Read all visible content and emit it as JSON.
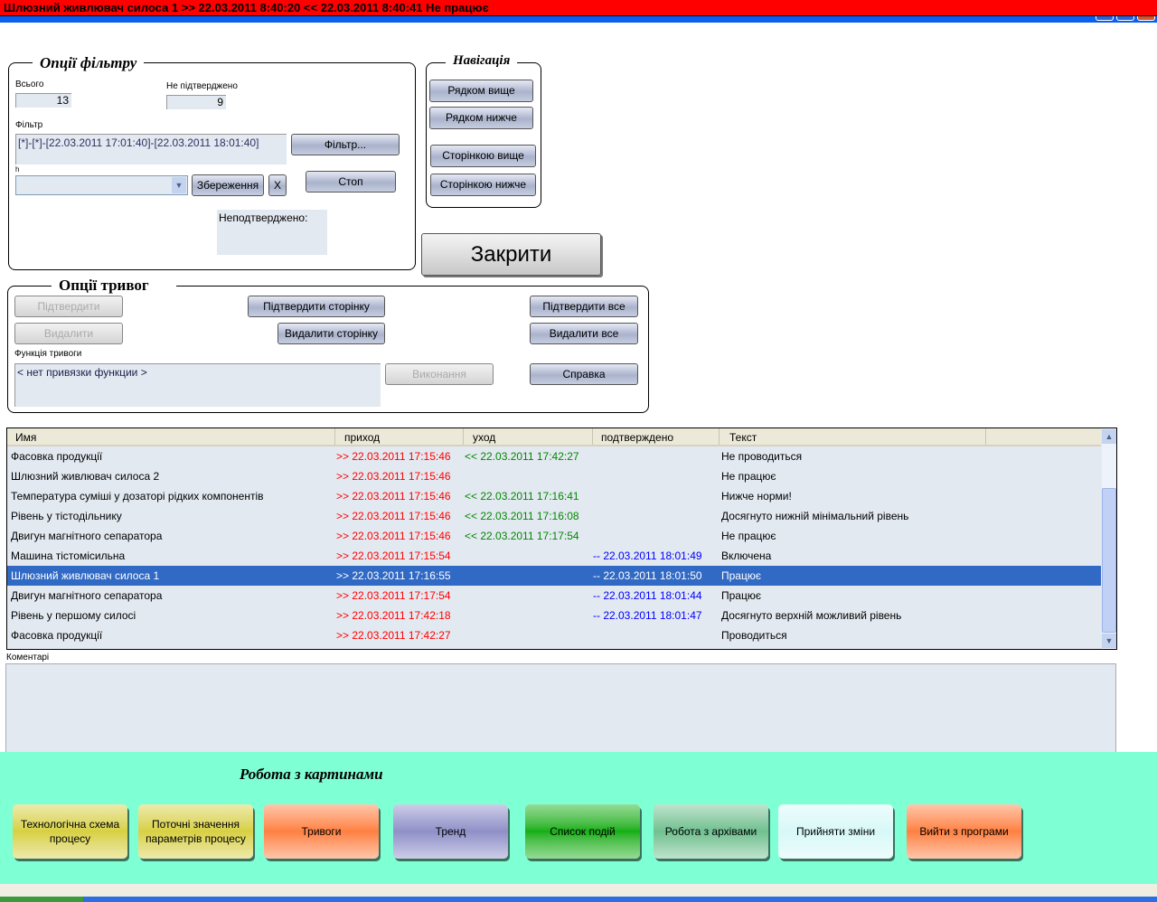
{
  "titlebar": {
    "text": "Шлюзний живлювач силоса 1 >> 22.03.2011 8:40:20 << 22.03.2011 8:40:41  Не працює"
  },
  "filter": {
    "title": "Опції фільтру",
    "total_label": "Всього",
    "total": "13",
    "unconfirmed_label": "Не підтверджено",
    "unconfirmed": "9",
    "filter_label": "Фільтр",
    "filter_value": "[*]-[*]-[22.03.2011 17:01:40]-[22.03.2011 18:01:40]",
    "filter_btn": "Фільтр...",
    "combo_label": "h",
    "save_btn": "Збереження",
    "x_btn": "X",
    "stop_btn": "Стоп",
    "unconf_text": "Неподтверджено:"
  },
  "nav": {
    "title": "Навігація",
    "row_up": "Рядком вище",
    "row_down": "Рядком нижче",
    "page_up": "Сторінкою вище",
    "page_down": "Сторінкою нижче"
  },
  "close_btn": "Закрити",
  "alarms": {
    "title": "Опції тривог",
    "confirm": "Підтвердити",
    "confirm_page": "Підтвердити сторінку",
    "confirm_all": "Підтвердити все",
    "delete": "Видалити",
    "delete_page": "Видалити сторінку",
    "delete_all": "Видалити все",
    "func_label": "Функція тривоги",
    "func_value": "< нет привязки функции >",
    "execute": "Виконання",
    "help": "Справка"
  },
  "table": {
    "columns": [
      "Имя",
      "приход",
      "уход",
      "подтверждено",
      "Текст"
    ],
    "rows": [
      {
        "name": "Фасовка продукції",
        "in": ">> 22.03.2011 17:15:46",
        "out": "<< 22.03.2011 17:42:27",
        "ack": "",
        "text": "Не проводиться"
      },
      {
        "name": "Шлюзний живлювач силоса 2",
        "in": ">> 22.03.2011 17:15:46",
        "out": "",
        "ack": "",
        "text": "Не працює"
      },
      {
        "name": "Температура суміші у дозаторі рідких компонентів",
        "in": ">> 22.03.2011 17:15:46",
        "out": "<< 22.03.2011 17:16:41",
        "ack": "",
        "text": "Нижче норми!"
      },
      {
        "name": "Рівень у тістодільнику",
        "in": ">> 22.03.2011 17:15:46",
        "out": "<< 22.03.2011 17:16:08",
        "ack": "",
        "text": "Досягнуто нижній мінімальний рівень"
      },
      {
        "name": "Двигун магнітного сепаратора",
        "in": ">> 22.03.2011 17:15:46",
        "out": "<< 22.03.2011 17:17:54",
        "ack": "",
        "text": "Не працює"
      },
      {
        "name": "Машина тістомісильна",
        "in": ">> 22.03.2011 17:15:54",
        "out": "",
        "ack": "-- 22.03.2011 18:01:49",
        "text": "Включена"
      },
      {
        "name": "Шлюзний живлювач силоса 1",
        "in": ">> 22.03.2011 17:16:55",
        "out": "",
        "ack": "-- 22.03.2011 18:01:50",
        "text": "Працює",
        "selected": true
      },
      {
        "name": "Двигун магнітного сепаратора",
        "in": ">> 22.03.2011 17:17:54",
        "out": "",
        "ack": "-- 22.03.2011 18:01:44",
        "text": "Працює"
      },
      {
        "name": "Рівень у першому силосі",
        "in": ">> 22.03.2011 17:42:18",
        "out": "",
        "ack": "-- 22.03.2011 18:01:47",
        "text": "Досягнуто верхній можливий рівень"
      },
      {
        "name": "Фасовка продукції",
        "in": ">> 22.03.2011 17:42:27",
        "out": "",
        "ack": "",
        "text": "Проводиться"
      }
    ]
  },
  "comments": {
    "label": "Коментарі"
  },
  "pictures": {
    "title": "Робота з картинами",
    "buttons": [
      {
        "label": "Технологічна схема процесу",
        "color": "#d8d040"
      },
      {
        "label": "Поточні значення параметрів процесу",
        "color": "#d8d040"
      },
      {
        "label": "Тривоги",
        "color": "#ff8040"
      },
      {
        "label": "Тренд",
        "color": "#9090c8"
      },
      {
        "label": "Список подій",
        "color": "#10b010"
      },
      {
        "label": "Робота з архівами",
        "color": "#70c090"
      },
      {
        "label": "Прийняти зміни",
        "color": "#d8f8f8"
      },
      {
        "label": "Вийти з програми",
        "color": "#ff8040"
      }
    ]
  }
}
